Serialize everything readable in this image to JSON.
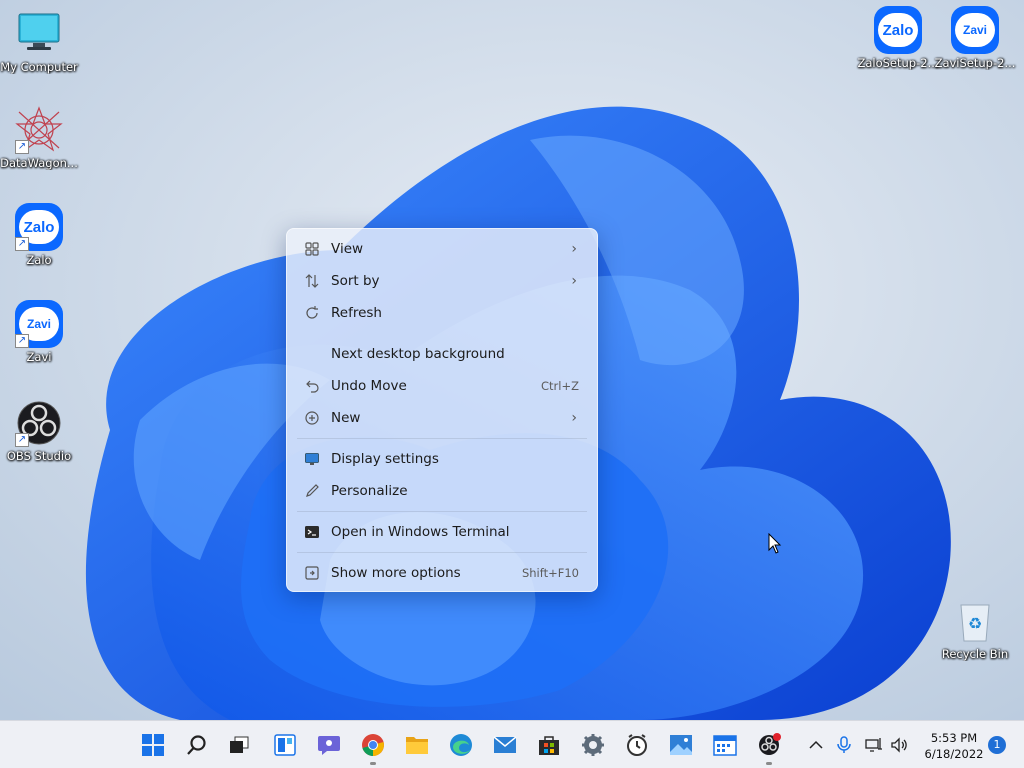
{
  "desktop_icons": {
    "my_computer": "My Computer",
    "datawagon": "DataWagon...",
    "zalo": "Zalo",
    "zavi": "Zavi",
    "obs": "OBS Studio",
    "zalo_setup": "ZaloSetup-2...",
    "zavi_setup": "ZaviSetup-2...",
    "recycle_bin": "Recycle Bin",
    "zalo_logo_text": "Zalo",
    "zavi_logo_text": "Zavi"
  },
  "context_menu": {
    "items": [
      {
        "label": "View",
        "icon": "view-grid-icon",
        "submenu": true
      },
      {
        "label": "Sort by",
        "icon": "sort-icon",
        "submenu": true
      },
      {
        "label": "Refresh",
        "icon": "refresh-icon"
      },
      {
        "label": "Next desktop background"
      },
      {
        "label": "Undo Move",
        "icon": "undo-icon",
        "shortcut": "Ctrl+Z"
      },
      {
        "label": "New",
        "icon": "new-plus-icon",
        "submenu": true
      },
      {
        "label": "Display settings",
        "icon": "display-icon"
      },
      {
        "label": "Personalize",
        "icon": "pen-icon"
      },
      {
        "label": "Open in Windows Terminal",
        "icon": "terminal-icon"
      },
      {
        "label": "Show more options",
        "icon": "more-options-icon",
        "shortcut": "Shift+F10"
      }
    ]
  },
  "taskbar": {
    "apps": [
      "start-icon",
      "search-icon",
      "task-view-icon",
      "widgets-icon",
      "chat-icon",
      "chrome-icon",
      "file-explorer-icon",
      "edge-icon",
      "mail-icon",
      "store-icon",
      "settings-icon",
      "clock-app-icon",
      "photos-icon",
      "calendar-icon",
      "obs-icon"
    ],
    "clock_time": "5:53 PM",
    "clock_date": "6/18/2022",
    "notification_count": "1"
  },
  "colors": {
    "accent": "#0b68ff",
    "taskbar_bg": "#eef0f5",
    "menu_bg": "#ecf0fa"
  }
}
